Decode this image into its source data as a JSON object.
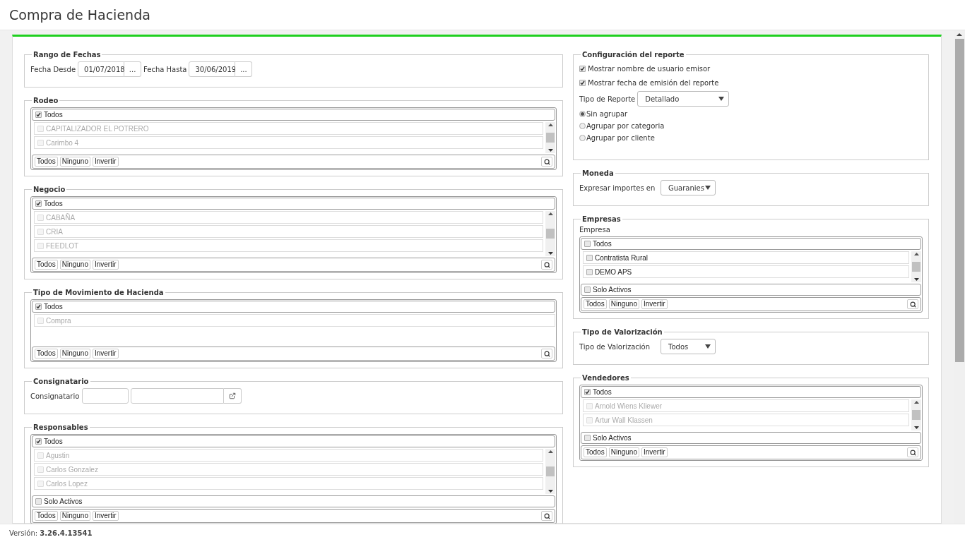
{
  "page": {
    "title": "Compra de Hacienda"
  },
  "left": [
    {
      "kind": "dates",
      "title": "Rango de Fechas",
      "fields": [
        {
          "label": "Fecha Desde",
          "value": "01/07/2018",
          "button": "..."
        },
        {
          "label": "Fecha Hasta",
          "value": "30/06/2019",
          "button": "..."
        }
      ]
    },
    {
      "kind": "multiselect",
      "title": "Rodeo",
      "scrollbar": true,
      "all": {
        "label": "Todos",
        "checked": true
      },
      "items": [
        {
          "label": "CAPITALIZADOR EL POTRERO",
          "checked": false,
          "disabled": true
        },
        {
          "label": "Carimbo 4",
          "checked": false,
          "disabled": true
        }
      ],
      "buttons": [
        "Todos",
        "Ninguno",
        "Invertir"
      ]
    },
    {
      "kind": "multiselect",
      "title": "Negocio",
      "scrollbar": true,
      "all": {
        "label": "Todos",
        "checked": true
      },
      "items": [
        {
          "label": "CABAÑA",
          "checked": false,
          "disabled": true
        },
        {
          "label": "CRIA",
          "checked": false,
          "disabled": true
        },
        {
          "label": "FEEDLOT",
          "checked": false,
          "disabled": true
        }
      ],
      "buttons": [
        "Todos",
        "Ninguno",
        "Invertir"
      ]
    },
    {
      "kind": "multiselect",
      "title": "Tipo de Movimiento de Hacienda",
      "scrollbar": false,
      "all": {
        "label": "Todos",
        "checked": true
      },
      "items": [
        {
          "label": "Compra",
          "checked": false,
          "disabled": true
        }
      ],
      "buttons": [
        "Todos",
        "Ninguno",
        "Invertir"
      ]
    },
    {
      "kind": "lookup",
      "title": "Consignatario",
      "label": "Consignatario"
    },
    {
      "kind": "multiselect",
      "title": "Responsables",
      "scrollbar": true,
      "all": {
        "label": "Todos",
        "checked": true
      },
      "items": [
        {
          "label": "Agustin",
          "checked": false,
          "disabled": true
        },
        {
          "label": "Carlos Gonzalez",
          "checked": false,
          "disabled": true
        },
        {
          "label": "Carlos Lopez",
          "checked": false,
          "disabled": true
        }
      ],
      "active_only": {
        "label": "Solo Activos",
        "checked": false
      },
      "buttons": [
        "Todos",
        "Ninguno",
        "Invertir"
      ]
    }
  ],
  "right": [
    {
      "kind": "config",
      "title": "Configuración del reporte",
      "checks": [
        {
          "label": "Mostrar nombre de usuario emisor",
          "checked": true
        },
        {
          "label": "Mostrar fecha de emisión del reporte",
          "checked": true
        }
      ],
      "select": {
        "label": "Tipo de Reporte",
        "value": "Detallado"
      },
      "radios": [
        {
          "label": "Sin agrupar",
          "selected": true
        },
        {
          "label": "Agrupar por categoria",
          "selected": false
        },
        {
          "label": "Agrupar por cliente",
          "selected": false
        }
      ]
    },
    {
      "kind": "select",
      "title": "Moneda",
      "label": "Expresar importes en",
      "value": "Guaranies"
    },
    {
      "kind": "multiselect",
      "title": "Empresas",
      "label": "Empresa",
      "scrollbar": true,
      "all": {
        "label": "Todos",
        "checked": false
      },
      "items": [
        {
          "label": "Contratista Rural",
          "checked": false,
          "disabled": false
        },
        {
          "label": "DEMO APS",
          "checked": false,
          "disabled": false
        }
      ],
      "active_only": {
        "label": "Solo Activos",
        "checked": false
      },
      "buttons": [
        "Todos",
        "Ninguno",
        "Invertir"
      ]
    },
    {
      "kind": "select",
      "title": "Tipo de Valorización",
      "label": "Tipo de Valorización",
      "value": "Todos"
    },
    {
      "kind": "multiselect",
      "title": "Vendedores",
      "scrollbar": true,
      "all": {
        "label": "Todos",
        "checked": true
      },
      "items": [
        {
          "label": "Arnold Wiens Kliewer",
          "checked": false,
          "disabled": true
        },
        {
          "label": "Artur Wall Klassen",
          "checked": false,
          "disabled": true
        }
      ],
      "active_only": {
        "label": "Solo Activos",
        "checked": false
      },
      "buttons": [
        "Todos",
        "Ninguno",
        "Invertir"
      ]
    }
  ],
  "footer": {
    "label": "Versión:",
    "version": "3.26.4.13541"
  }
}
